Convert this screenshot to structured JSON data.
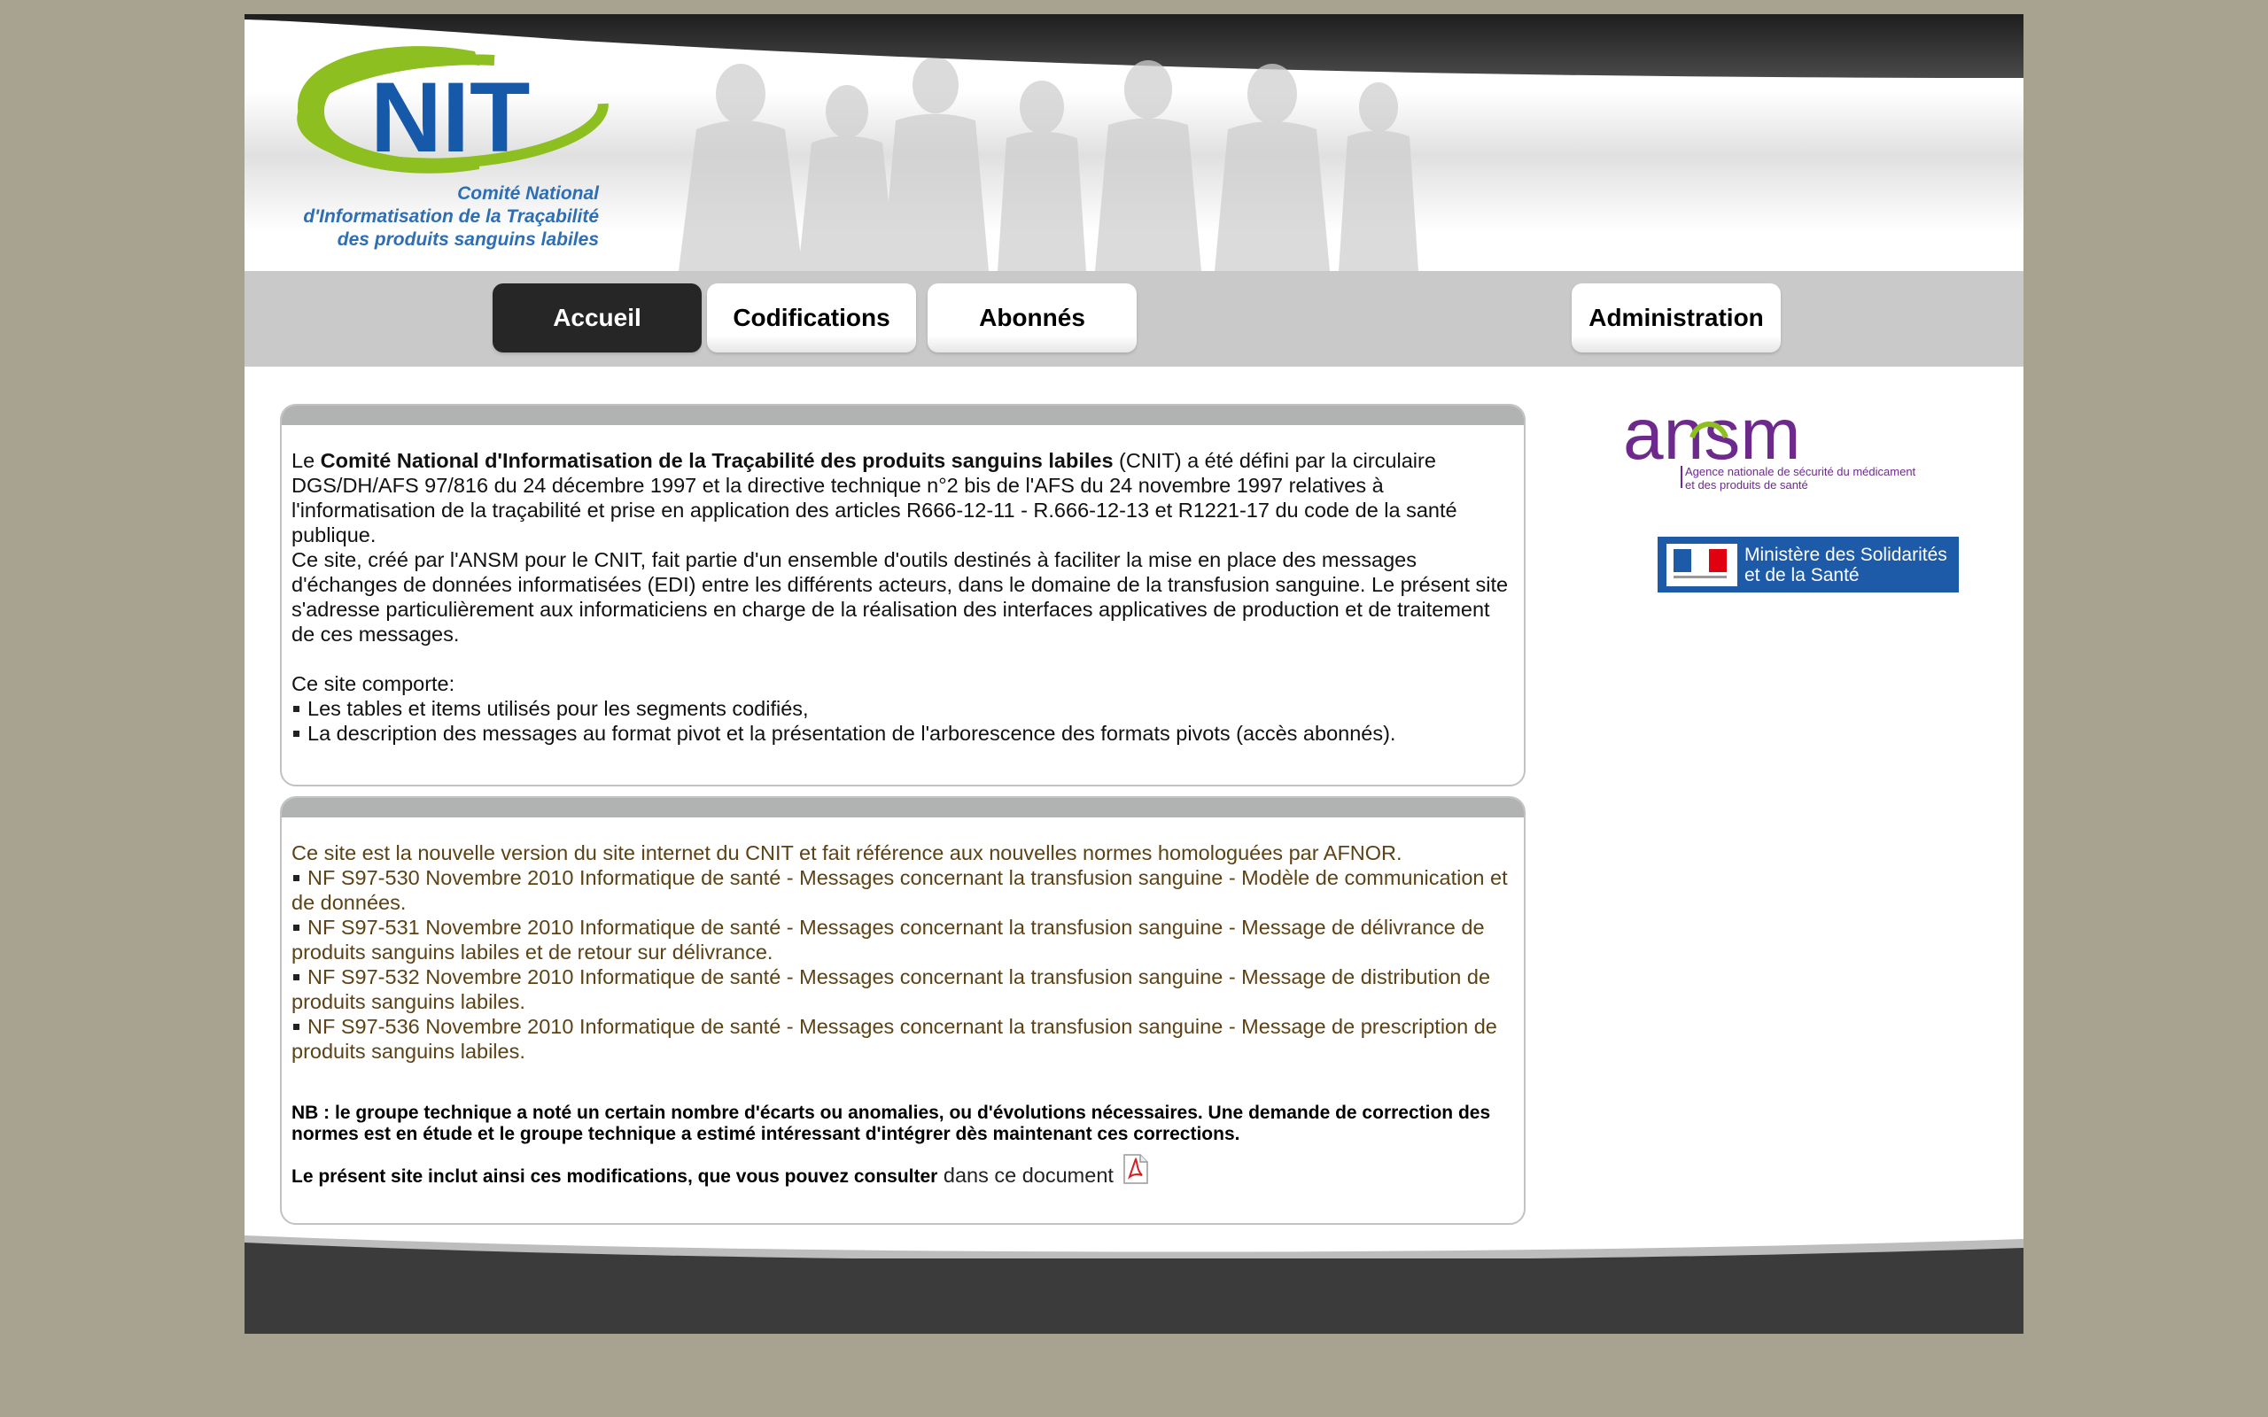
{
  "logo": {
    "wordmark": "NIT",
    "tagline": [
      "Comité National",
      "d'Informatisation de la Traçabilité",
      "des produits sanguins labiles"
    ]
  },
  "nav": {
    "items": [
      {
        "label": "Accueil",
        "active": true
      },
      {
        "label": "Codifications",
        "active": false
      },
      {
        "label": "Abonnés",
        "active": false
      },
      {
        "label": "Administration",
        "active": false
      }
    ]
  },
  "intro": {
    "p1_prefix": "Le ",
    "p1_bold": "Comité National d'Informatisation de la Traçabilité des produits sanguins labiles",
    "p1_rest": " (CNIT) a été défini par la circulaire DGS/DH/AFS 97/816 du 24 décembre 1997 et la directive technique n°2 bis de l'AFS du 24 novembre 1997 relatives à l'informatisation de la traçabilité et prise en application des articles R666-12-11 - R.666-12-13 et R1221-17 du code de la santé publique.",
    "p2": "Ce site, créé par l'ANSM pour le CNIT, fait partie d'un ensemble d'outils destinés à faciliter la mise en place des messages d'échanges de données informatisées (EDI) entre les différents acteurs, dans le domaine de la transfusion sanguine. Le présent site s'adresse particulièrement aux informaticiens en charge de la réalisation des interfaces applicatives de production et de traitement de ces messages.",
    "list_title": "Ce site comporte:",
    "list": [
      "Les tables et items utilisés pour les segments codifiés,",
      "La description des messages au format pivot et la présentation de l'arborescence des formats pivots (accès abonnés)."
    ]
  },
  "norms": {
    "intro": "Ce site est la nouvelle version du site internet du CNIT et fait référence aux nouvelles normes homologuées par AFNOR.",
    "items": [
      "NF S97-530 Novembre 2010 Informatique de santé - Messages concernant la transfusion sanguine - Modèle de communication et de données.",
      "NF S97-531 Novembre 2010 Informatique de santé - Messages concernant la transfusion sanguine - Message de délivrance de produits sanguins labiles et de retour sur délivrance.",
      "NF S97-532 Novembre 2010 Informatique de santé - Messages concernant la transfusion sanguine - Message de distribution de produits sanguins labiles.",
      "NF S97-536 Novembre 2010 Informatique de santé - Messages concernant la transfusion sanguine - Message de prescription de produits sanguins labiles."
    ],
    "nb": "NB : le groupe technique a noté un certain nombre d'écarts ou anomalies, ou d'évolutions nécessaires. Une demande de correction des normes est en étude et le groupe technique a estimé intéressant d'intégrer dès maintenant ces corrections.",
    "doc_bold": "Le présent site inclut ainsi ces modifications, que vous pouvez consulter",
    "doc_link": " dans ce document"
  },
  "partners": {
    "ansm_wordmark": "ansm",
    "ansm_caption": [
      "Agence nationale de sécurité du médicament",
      "et des produits de santé"
    ],
    "ministere": [
      "Ministère des Solidarités",
      "et de la Santé"
    ]
  },
  "icons": {
    "pdf": "pdf-file-icon"
  },
  "colors": {
    "background": "#a8a391",
    "nav_active": "#262626",
    "logo_green": "#8cbf1f",
    "logo_blue": "#1659a8",
    "ansm_purple": "#6d2a8c",
    "text_brown": "#5c4215",
    "footer": "#3b3b3b"
  }
}
